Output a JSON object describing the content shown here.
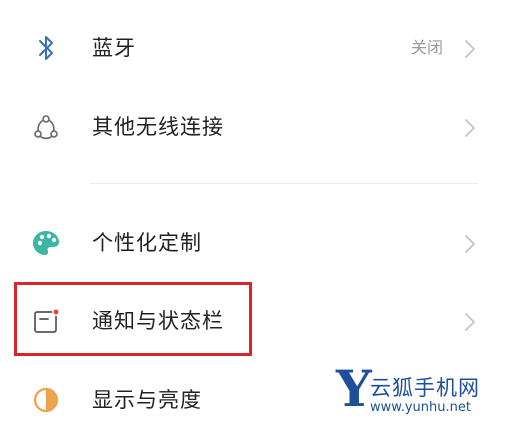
{
  "settings": {
    "items": [
      {
        "label": "蓝牙",
        "status": "关闭",
        "icon": "bluetooth-icon"
      },
      {
        "label": "其他无线连接",
        "icon": "wireless-share-icon"
      },
      {
        "label": "个性化定制",
        "icon": "palette-icon"
      },
      {
        "label": "通知与状态栏",
        "icon": "notification-icon"
      },
      {
        "label": "显示与亮度",
        "icon": "brightness-icon"
      }
    ]
  },
  "watermark": {
    "letter": "Y",
    "name": "云狐手机网",
    "url": "www.yunhu.net"
  },
  "colors": {
    "bluetooth": "#3d6fb3",
    "highlight_border": "#d9262c",
    "notification_dot": "#e0443a",
    "brightness": "#f0a24a",
    "watermark": "#1f4f9a"
  }
}
